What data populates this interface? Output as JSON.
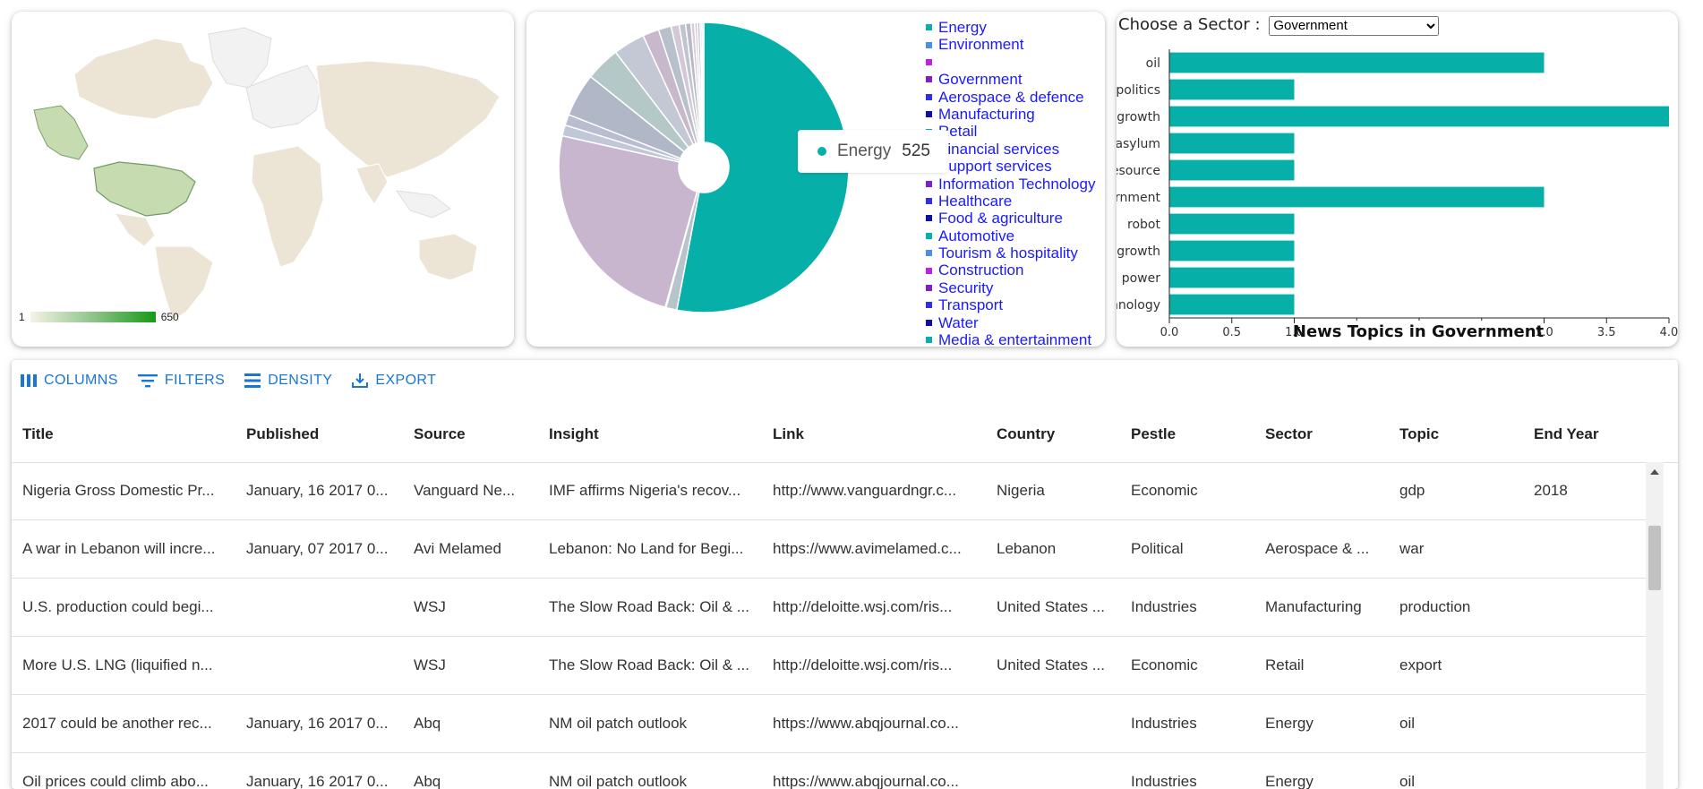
{
  "map": {
    "legend_min": "1",
    "legend_max": "650",
    "colors": {
      "land": "#ece4d4",
      "nodata": "#f2f2f2",
      "highlight": "#c6dbb0",
      "high": "#9dc591",
      "border": "#ffffff"
    }
  },
  "pie": {
    "tooltip": {
      "label": "Energy",
      "value": "525",
      "color": "#06b0a8"
    },
    "legend": [
      {
        "label": "Energy",
        "color": "#06b0a8"
      },
      {
        "label": "Environment",
        "color": "#4a90e2"
      },
      {
        "label": "",
        "color": "#c020e0"
      },
      {
        "label": "Government",
        "color": "#8020c0"
      },
      {
        "label": "Aerospace & defence",
        "color": "#3030e0"
      },
      {
        "label": "Manufacturing",
        "color": "#1010a0"
      },
      {
        "label": "Retail",
        "color": "#06b0a8"
      },
      {
        "label": "Financial services",
        "color": "#4a90e2"
      },
      {
        "label": "Support services",
        "color": "#c020e0"
      },
      {
        "label": "Information Technology",
        "color": "#8020c0"
      },
      {
        "label": "Healthcare",
        "color": "#3030e0"
      },
      {
        "label": "Food & agriculture",
        "color": "#1010a0"
      },
      {
        "label": "Automotive",
        "color": "#06b0a8"
      },
      {
        "label": "Tourism & hospitality",
        "color": "#4a90e2"
      },
      {
        "label": "Construction",
        "color": "#c020e0"
      },
      {
        "label": "Security",
        "color": "#8020c0"
      },
      {
        "label": "Transport",
        "color": "#3030e0"
      },
      {
        "label": "Water",
        "color": "#1010a0"
      },
      {
        "label": "Media & entertainment",
        "color": "#06b0a8"
      }
    ]
  },
  "sector_select": {
    "label": "Choose a Sector :",
    "value": "Government",
    "options": [
      "Government"
    ]
  },
  "chart_data": [
    {
      "type": "pie",
      "categories": [
        "Energy",
        "Environment",
        "",
        "Government",
        "Aerospace & defence",
        "Manufacturing",
        "Retail",
        "Financial services",
        "Support services",
        "Information Technology",
        "Healthcare",
        "Food & agriculture",
        "Automotive",
        "Tourism & hospitality",
        "Construction",
        "Security",
        "Transport",
        "Water",
        "Media & entertainment"
      ],
      "values": [
        525,
        12,
        1,
        240,
        12,
        12,
        48,
        38,
        35,
        18,
        14,
        9,
        7,
        6,
        4,
        3,
        3,
        2,
        2
      ],
      "colors": [
        "#06b0a8",
        "#b8c4cc",
        "#d0d0d8",
        "#c8b6cf",
        "#c0c8d8",
        "#b8bed0",
        "#b0b8c8",
        "#b5c8c8",
        "#c4c8d4",
        "#c8b8cc",
        "#b8c0cc",
        "#d4c8d8",
        "#c0c4d0",
        "#b8b8c8",
        "#d8ccd8",
        "#d0c8d8",
        "#c4c0d0",
        "#d8d0dc",
        "#e0d8e4"
      ],
      "title": "",
      "hole": true
    },
    {
      "type": "bar",
      "orientation": "horizontal",
      "title": "News Topics in Government",
      "categories": [
        "oil",
        "politics",
        "growth",
        "asylum",
        "resource",
        "government",
        "robot",
        "growth",
        "power",
        "technology"
      ],
      "values": [
        3,
        1,
        4,
        1,
        1,
        3,
        1,
        1,
        1,
        1
      ],
      "xlim": [
        0,
        4
      ],
      "xticks": [
        "0.0",
        "0.5",
        "1.0",
        "1.5",
        "2.0",
        "2.5",
        "3.0",
        "3.5",
        "4.0"
      ],
      "color": "#06b0a8"
    }
  ],
  "grid": {
    "toolbar": [
      {
        "label": "COLUMNS",
        "icon": "columns-icon"
      },
      {
        "label": "FILTERS",
        "icon": "filter-icon"
      },
      {
        "label": "DENSITY",
        "icon": "density-icon"
      },
      {
        "label": "EXPORT",
        "icon": "export-icon"
      }
    ],
    "columns": [
      "Title",
      "Published",
      "Source",
      "Insight",
      "Link",
      "Country",
      "Pestle",
      "Sector",
      "Topic",
      "End Year"
    ],
    "rows": [
      [
        "Nigeria Gross Domestic Pr...",
        "January, 16 2017 0...",
        "Vanguard Ne...",
        "IMF affirms Nigeria's recov...",
        "http://www.vanguardngr.c...",
        "Nigeria",
        "Economic",
        "",
        "gdp",
        "2018"
      ],
      [
        "A war in Lebanon will incre...",
        "January, 07 2017 0...",
        "Avi Melamed",
        "Lebanon: No Land for Begi...",
        "https://www.avimelamed.c...",
        "Lebanon",
        "Political",
        "Aerospace & ...",
        "war",
        ""
      ],
      [
        "U.S. production could begi...",
        "",
        "WSJ",
        "The Slow Road Back: Oil & ...",
        "http://deloitte.wsj.com/ris...",
        "United States ...",
        "Industries",
        "Manufacturing",
        "production",
        ""
      ],
      [
        "More U.S. LNG (liquified n...",
        "",
        "WSJ",
        "The Slow Road Back: Oil & ...",
        "http://deloitte.wsj.com/ris...",
        "United States ...",
        "Economic",
        "Retail",
        "export",
        ""
      ],
      [
        "2017 could be another rec...",
        "January, 16 2017 0...",
        "Abq",
        "NM oil patch outlook",
        "https://www.abqjournal.co...",
        "",
        "Industries",
        "Energy",
        "oil",
        ""
      ],
      [
        "Oil prices could climb abo...",
        "January, 16 2017 0...",
        "Abq",
        "NM oil patch outlook",
        "https://www.abqjournal.co...",
        "",
        "Industries",
        "Energy",
        "oil",
        ""
      ]
    ]
  }
}
